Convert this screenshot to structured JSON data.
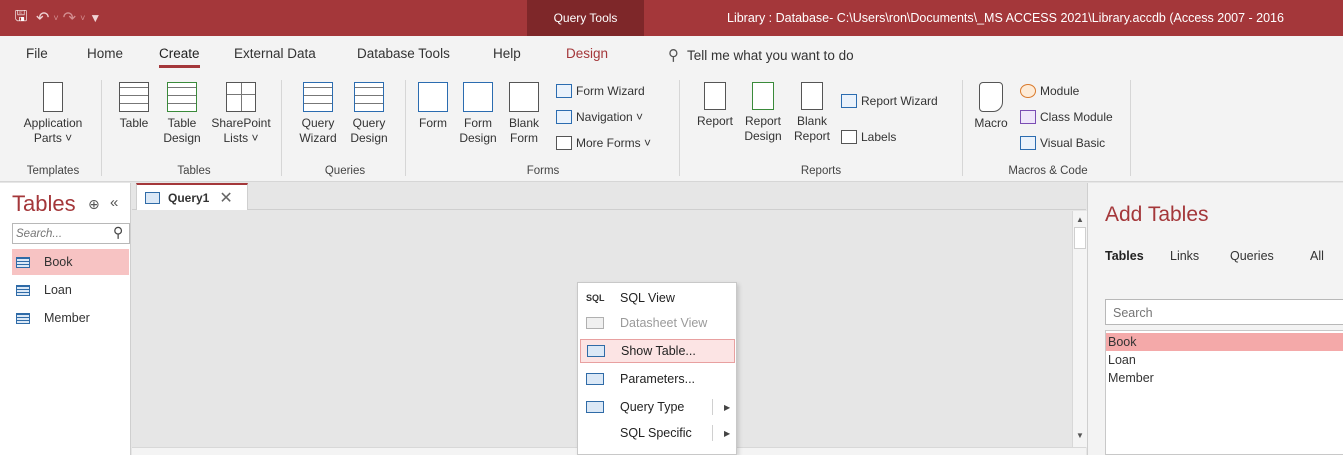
{
  "titlebar": {
    "save_icon": "save-icon",
    "undo_icon": "undo-icon",
    "redo_icon": "redo-icon",
    "customize_icon": "customize-qat-icon",
    "tools_tab": "Query Tools",
    "window_title": "Library : Database- C:\\Users\\ron\\Documents\\_MS ACCESS 2021\\Library.accdb (Access 2007 - 2016"
  },
  "ribbon_tabs": [
    "File",
    "Home",
    "Create",
    "External Data",
    "Database Tools",
    "Help",
    "Design"
  ],
  "active_tab": "Create",
  "tell_me": "Tell me what you want to do",
  "ribbon": {
    "templates": {
      "label": "Templates",
      "app_parts_1": "Application",
      "app_parts_2": "Parts ˅"
    },
    "tables": {
      "label": "Tables",
      "table": "Table",
      "table_design_1": "Table",
      "table_design_2": "Design",
      "sharepoint_1": "SharePoint",
      "sharepoint_2": "Lists ˅"
    },
    "queries": {
      "label": "Queries",
      "wizard_1": "Query",
      "wizard_2": "Wizard",
      "design_1": "Query",
      "design_2": "Design"
    },
    "forms": {
      "label": "Forms",
      "form": "Form",
      "form_design_1": "Form",
      "form_design_2": "Design",
      "blank_form_1": "Blank",
      "blank_form_2": "Form",
      "form_wizard": "Form Wizard",
      "navigation": "Navigation ˅",
      "more_forms": "More Forms ˅"
    },
    "reports": {
      "label": "Reports",
      "report": "Report",
      "report_design_1": "Report",
      "report_design_2": "Design",
      "blank_report_1": "Blank",
      "blank_report_2": "Report",
      "report_wizard": "Report Wizard",
      "labels": "Labels"
    },
    "macros": {
      "label": "Macros & Code",
      "macro": "Macro",
      "module": "Module",
      "class_module": "Class Module",
      "visual_basic": "Visual Basic"
    }
  },
  "nav": {
    "title": "Tables",
    "dropdown_icon": "circle-chevron-down-icon",
    "collapse_icon": "double-chevron-left-icon",
    "search_placeholder": "Search...",
    "items": [
      "Book",
      "Loan",
      "Member"
    ],
    "selected": "Book"
  },
  "document": {
    "tab_label": "Query1",
    "close_glyph": "✕"
  },
  "context_menu": {
    "items": [
      {
        "icon": "SQL",
        "label": "SQL View",
        "enabled": true
      },
      {
        "icon": "datasheet-icon",
        "label": "Datasheet View",
        "enabled": false
      },
      {
        "icon": "show-table-icon",
        "label": "Show Table...",
        "enabled": true,
        "highlighted": true
      },
      {
        "icon": "parameters-icon",
        "label": "Parameters...",
        "enabled": true
      },
      {
        "icon": "query-type-icon",
        "label": "Query Type",
        "enabled": true,
        "submenu": true
      },
      {
        "icon": "",
        "label": "SQL Specific",
        "enabled": true,
        "submenu": true
      }
    ]
  },
  "add_tables": {
    "title": "Add Tables",
    "tabs": [
      "Tables",
      "Links",
      "Queries",
      "All"
    ],
    "active_tab": "Tables",
    "search_placeholder": "Search",
    "items": [
      "Book",
      "Loan",
      "Member"
    ],
    "selected": "Book"
  },
  "colors": {
    "accent": "#a4373a",
    "selection": "#f7c3c3",
    "list_selection": "#f4a9a9"
  }
}
